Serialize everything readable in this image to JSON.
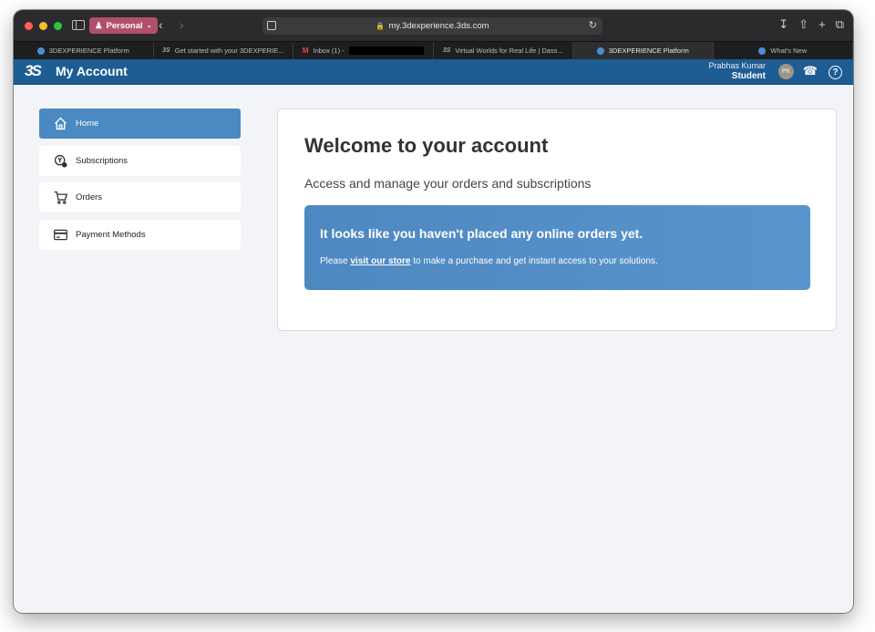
{
  "browser": {
    "profile_label": "Personal",
    "url": "my.3dexperience.3ds.com",
    "tabs": [
      {
        "label": "3DEXPERIENCE Platform",
        "icon": "globe-icon"
      },
      {
        "label": "Get started with your 3DEXPERIE...",
        "icon": "ds-icon"
      },
      {
        "label": "Inbox (1) -",
        "icon": "gmail-icon"
      },
      {
        "label": "Virtual Worlds for Real Life | Dass...",
        "icon": "ds-icon"
      },
      {
        "label": "3DEXPERIENCE Platform",
        "icon": "globe-icon",
        "active": true
      },
      {
        "label": "What's New",
        "icon": "globe-icon"
      }
    ]
  },
  "header": {
    "logo": "3S",
    "title": "My Account",
    "user_name": "Prabhas Kumar",
    "user_role": "Student",
    "avatar_initials": "PK",
    "help_glyph": "?"
  },
  "sidebar": {
    "items": [
      {
        "label": "Home",
        "icon": "home-icon",
        "active": true
      },
      {
        "label": "Subscriptions",
        "icon": "subscriptions-icon"
      },
      {
        "label": "Orders",
        "icon": "cart-icon"
      },
      {
        "label": "Payment Methods",
        "icon": "credit-card-icon"
      }
    ]
  },
  "main": {
    "title": "Welcome to your account",
    "subtitle": "Access and manage your orders and subscriptions",
    "notice": {
      "title": "It looks like you haven't placed any online orders yet.",
      "body_prefix": "Please",
      "link_text": "visit our store",
      "body_suffix": "to make a purchase and get instant access to your solutions."
    }
  },
  "colors": {
    "header_bg": "#1e5c94",
    "active_nav": "#4a89c2",
    "notice_bg": "#4d88c0",
    "page_bg": "#f2f4f7"
  }
}
